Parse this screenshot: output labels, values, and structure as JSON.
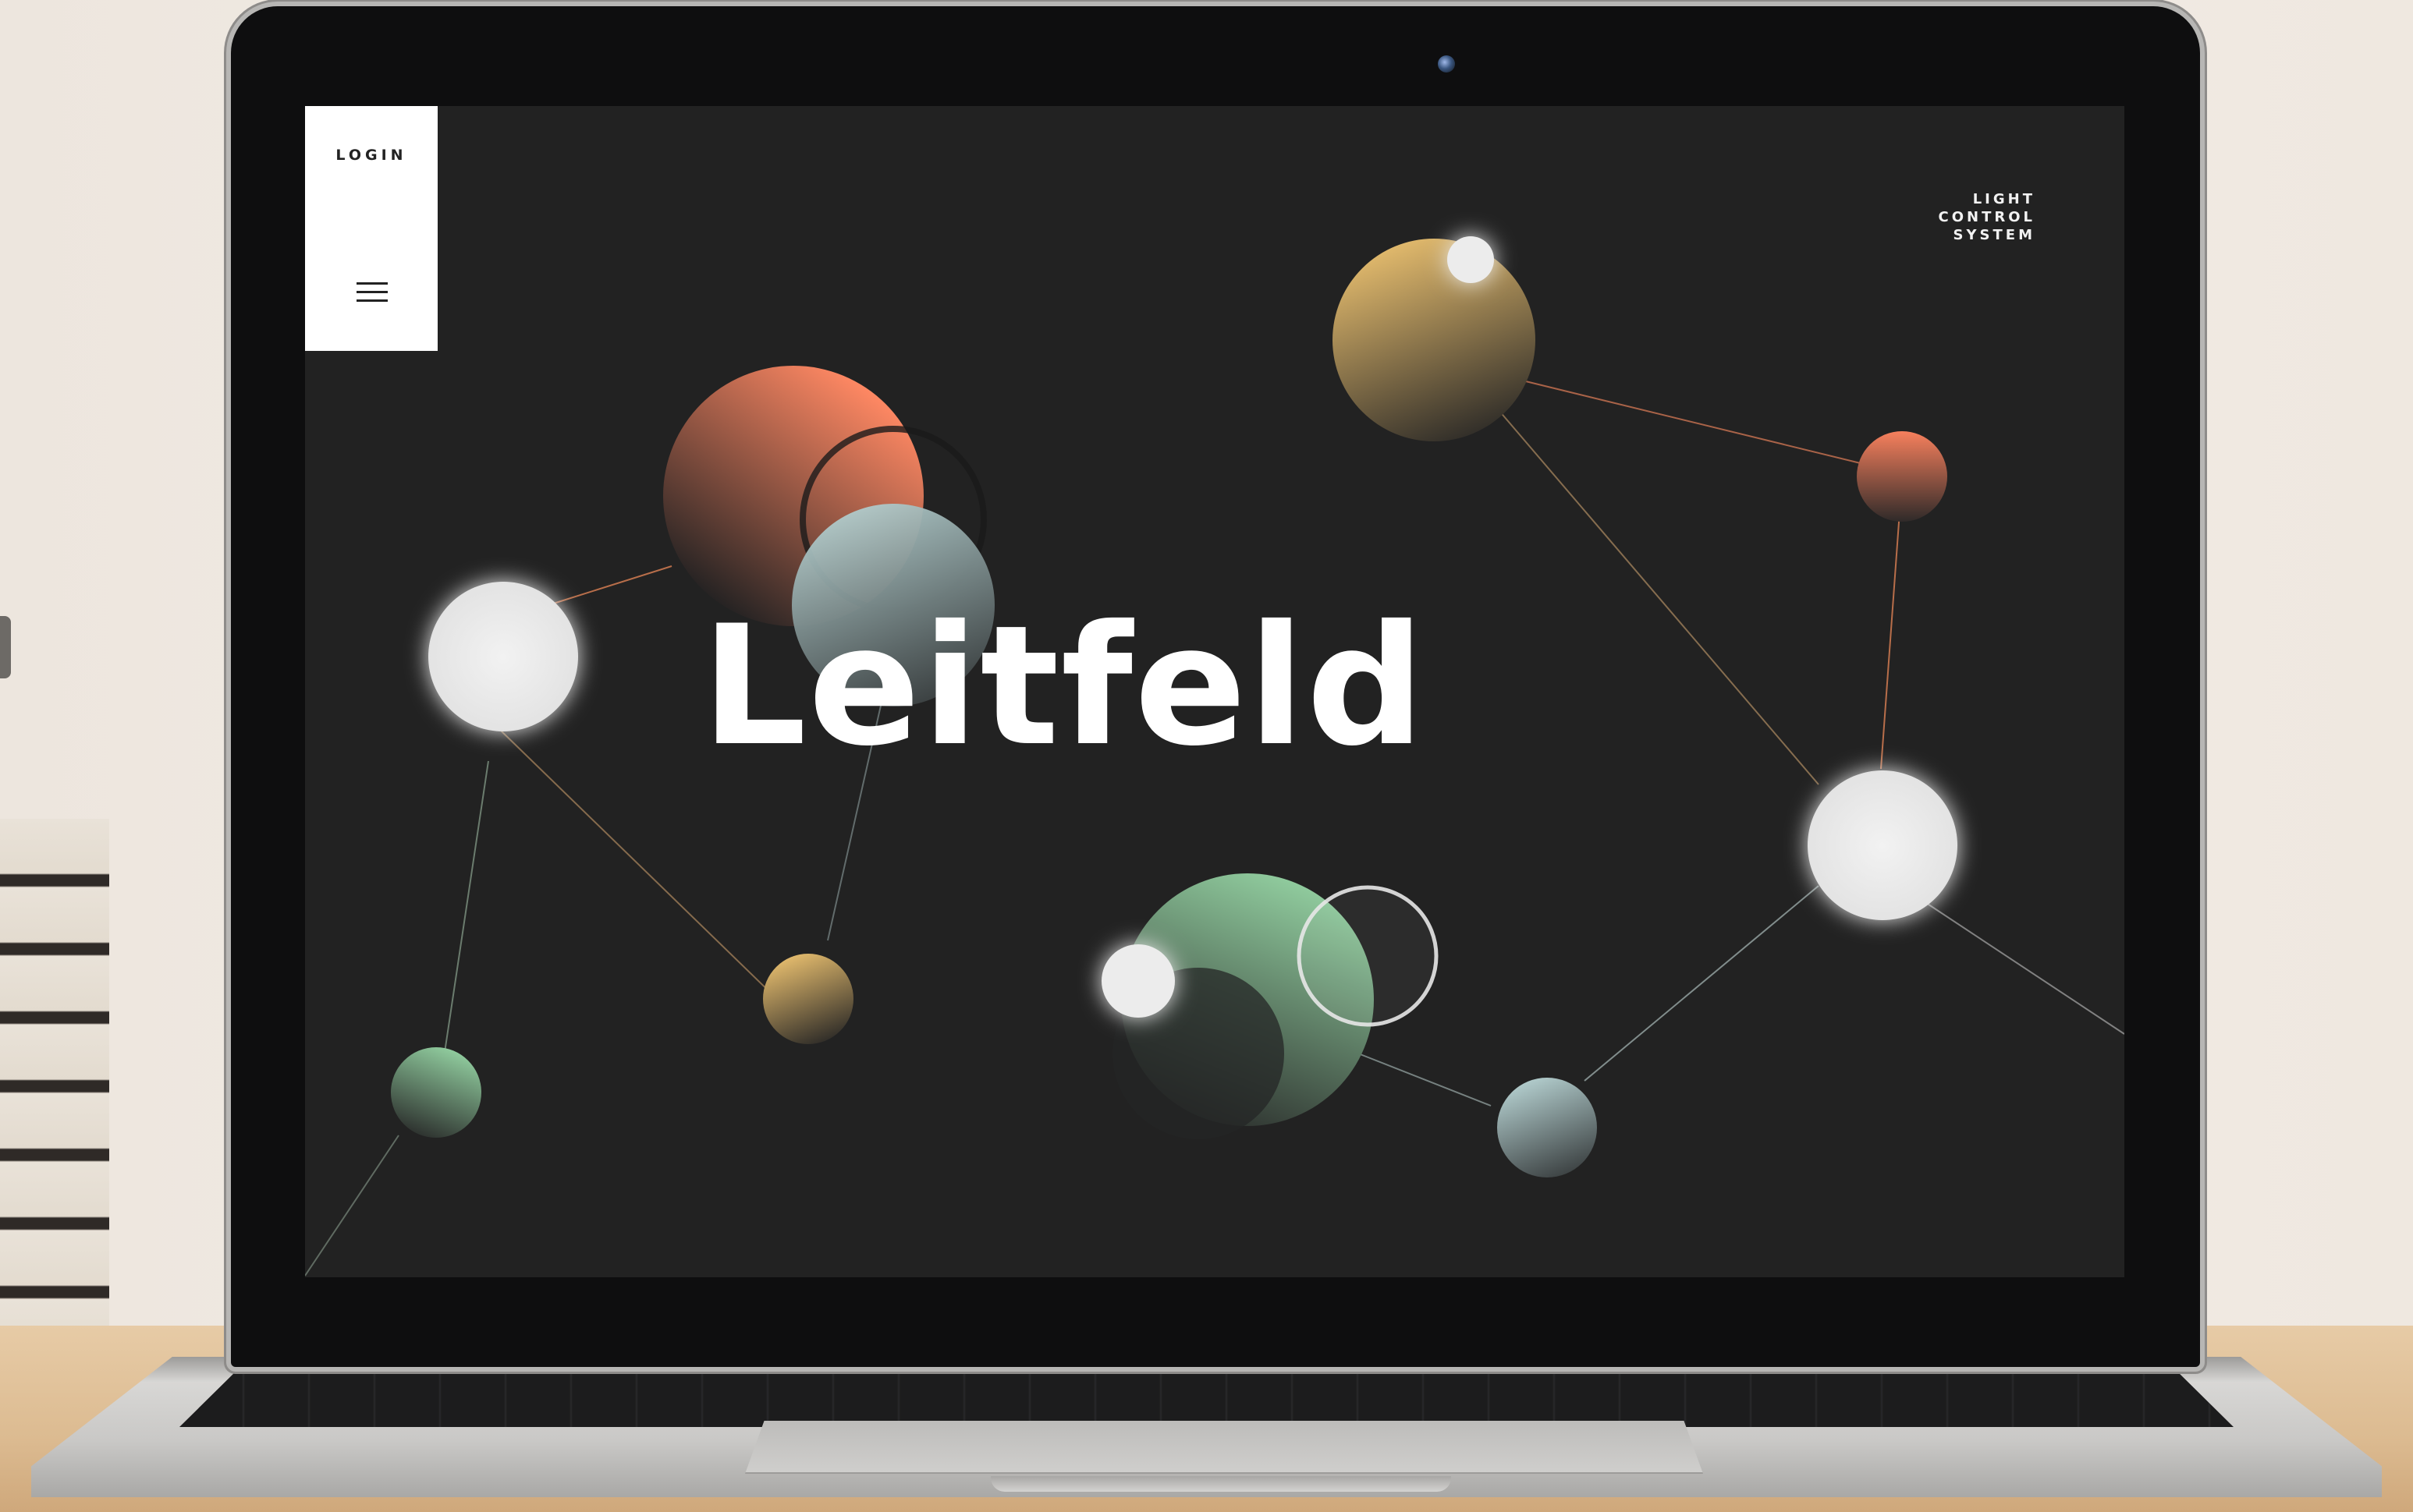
{
  "site": {
    "login_label": "LOGIN",
    "tagline": [
      "LIGHT",
      "CONTROL",
      "SYSTEM"
    ],
    "title": "Leitfeld"
  },
  "icons": {
    "menu": "hamburger-menu-icon",
    "camera": "webcam"
  },
  "colors": {
    "screen_background": "#222222",
    "menu_panel": "#ffffff",
    "orb_coral": "#f7805d",
    "orb_gold": "#e3b96b",
    "orb_sage": "#8cc79a",
    "orb_slate": "#a9c3c4",
    "orb_white": "#ececec"
  }
}
